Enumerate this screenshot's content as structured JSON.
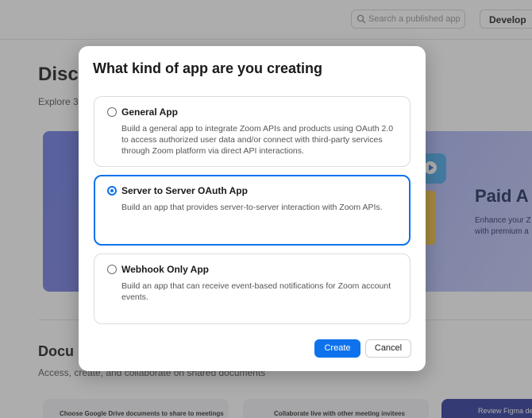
{
  "background": {
    "search_placeholder": "Search a published app",
    "develop_label": "Develop",
    "discover_title": "Disc",
    "discover_subtitle": "Explore 3",
    "paid_title": "Paid A",
    "paid_sub1": "Enhance your Z",
    "paid_sub2": "with premium a",
    "documents_title": "Docu",
    "documents_subtitle": "Access, create, and collaborate on shared documents",
    "card1_text": "Choose Google Drive documents to share to meetings",
    "card2_text": "Collaborate live with other meeting invitees",
    "card3_text": "Review Figma de"
  },
  "modal": {
    "title": "What kind of app are you creating",
    "options": [
      {
        "title": "General App",
        "description": "Build a general app to integrate Zoom APIs and products using OAuth 2.0 to access authorized user data and/or connect with third-party services through Zoom platform via direct API interactions.",
        "selected": false
      },
      {
        "title": "Server to Server OAuth App",
        "description": "Build an app that provides server-to-server interaction with Zoom APIs.",
        "selected": true
      },
      {
        "title": "Webhook Only App",
        "description": "Build an app that can receive event-based notifications for Zoom account events.",
        "selected": false
      }
    ],
    "create_label": "Create",
    "cancel_label": "Cancel"
  },
  "colors": {
    "accent": "#0e72ed",
    "overlay": "rgba(60,60,60,0.42)"
  },
  "icons": {
    "search": "search-icon",
    "play": "play-icon"
  }
}
